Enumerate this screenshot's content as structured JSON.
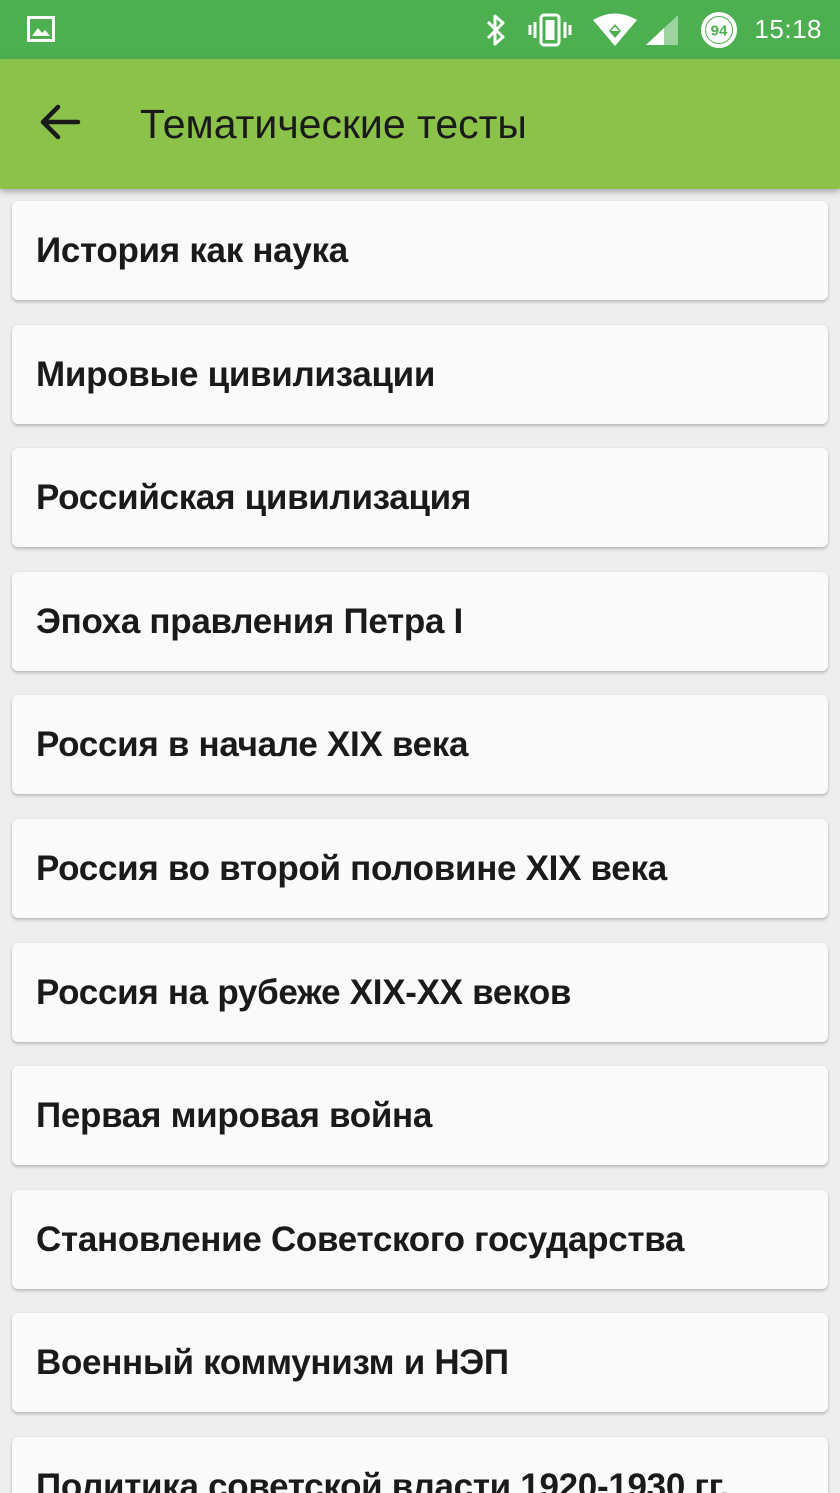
{
  "status_bar": {
    "time": "15:18",
    "battery_level": "94",
    "icons": [
      "gallery-icon",
      "bluetooth-icon",
      "vibrate-icon",
      "wifi-icon",
      "signal-icon",
      "battery-icon"
    ]
  },
  "app_bar": {
    "title": "Тематические тесты",
    "back_icon": "arrow-back-icon"
  },
  "colors": {
    "status_bar": "#4caf50",
    "app_bar": "#8bc34a",
    "background": "#eeeeee",
    "card": "#fafafa"
  },
  "topics": [
    {
      "label": "История как наука"
    },
    {
      "label": "Мировые цивилизации"
    },
    {
      "label": "Российская цивилизация"
    },
    {
      "label": "Эпоха правления Петра I"
    },
    {
      "label": "Россия в начале XIX века"
    },
    {
      "label": "Россия во второй половине XIX века"
    },
    {
      "label": "Россия на рубеже XIX-XX веков"
    },
    {
      "label": "Первая мировая война"
    },
    {
      "label": "Становление Советского государства"
    },
    {
      "label": "Военный коммунизм и НЭП"
    },
    {
      "label": "Политика советской власти 1920-1930 гг."
    }
  ]
}
